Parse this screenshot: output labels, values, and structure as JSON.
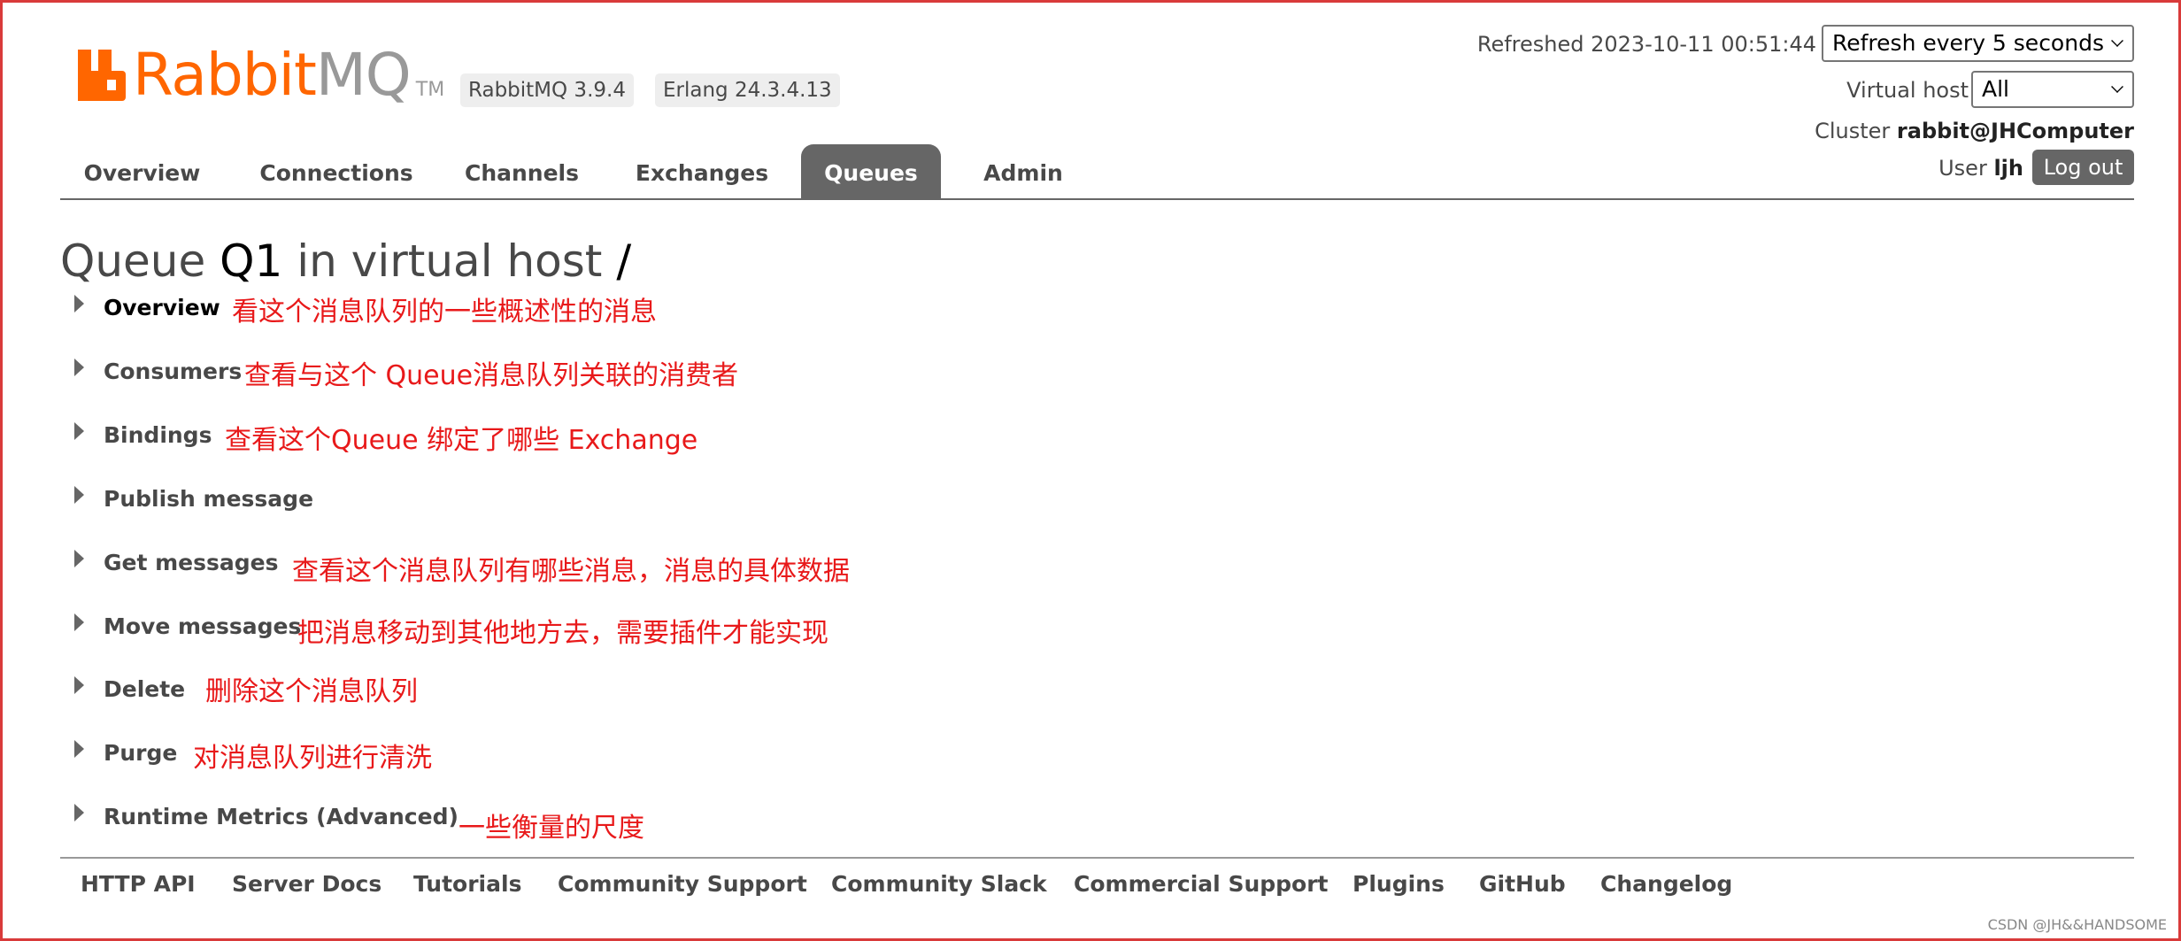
{
  "header": {
    "logo_rabbit": "Rabbit",
    "logo_mq": "MQ",
    "logo_tm": "TM",
    "rabbitmq_version": "RabbitMQ 3.9.4",
    "erlang_version": "Erlang 24.3.4.13",
    "refreshed": "Refreshed 2023-10-11 00:51:44",
    "refresh_select": "Refresh every 5 seconds",
    "vhost_label": "Virtual host",
    "vhost_select": "All",
    "cluster_label": "Cluster",
    "cluster_name": "rabbit@JHComputer",
    "user_label": "User",
    "user_name": "ljh",
    "logout_label": "Log out"
  },
  "tabs": [
    {
      "label": "Overview",
      "active": false
    },
    {
      "label": "Connections",
      "active": false
    },
    {
      "label": "Channels",
      "active": false
    },
    {
      "label": "Exchanges",
      "active": false
    },
    {
      "label": "Queues",
      "active": true
    },
    {
      "label": "Admin",
      "active": false
    }
  ],
  "title": {
    "prefix": "Queue",
    "queue_name": "Q1",
    "middle": "in virtual host",
    "vhost": "/"
  },
  "sections": [
    {
      "label": "Overview",
      "note": "看这个消息队列的一些概述性的消息"
    },
    {
      "label": "Consumers",
      "note": "查看与这个 Queue消息队列关联的消费者"
    },
    {
      "label": "Bindings",
      "note": "查看这个Queue 绑定了哪些 Exchange"
    },
    {
      "label": "Publish message",
      "note": ""
    },
    {
      "label": "Get messages",
      "note": "查看这个消息队列有哪些消息，消息的具体数据"
    },
    {
      "label": "Move messages",
      "note": "把消息移动到其他地方去，需要插件才能实现"
    },
    {
      "label": "Delete",
      "note": "删除这个消息队列"
    },
    {
      "label": "Purge",
      "note": "对消息队列进行清洗"
    },
    {
      "label": "Runtime Metrics (Advanced)",
      "note": "一些衡量的尺度"
    }
  ],
  "footer": [
    "HTTP API",
    "Server Docs",
    "Tutorials",
    "Community Support",
    "Community Slack",
    "Commercial Support",
    "Plugins",
    "GitHub",
    "Changelog"
  ],
  "watermark": "CSDN @JH&&HANDSOME",
  "colors": {
    "brand_orange": "#ff6600",
    "annotation_red": "#e8191a",
    "active_tab": "#666666"
  }
}
